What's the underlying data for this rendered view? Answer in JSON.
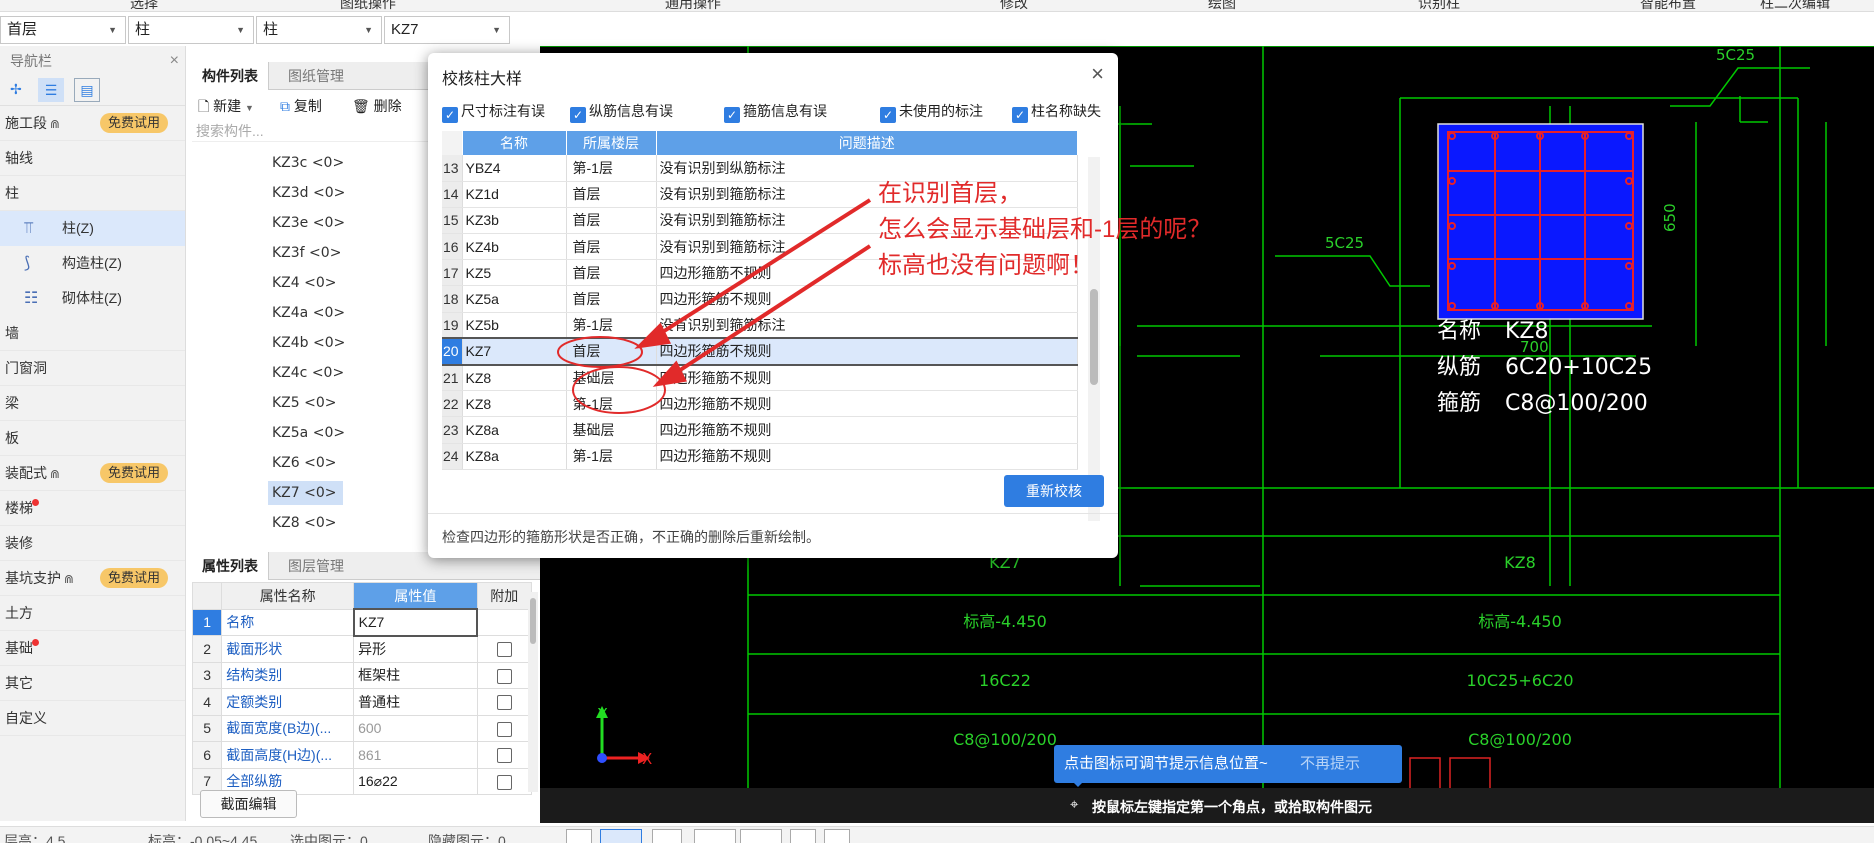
{
  "top_menu": [
    "选择",
    "图纸操作",
    "通用操作",
    "修改",
    "绘图",
    "识别柱",
    "智能布置",
    "柱二次编辑"
  ],
  "selectors": [
    {
      "value": "首层"
    },
    {
      "value": "柱"
    },
    {
      "value": "柱"
    },
    {
      "value": "KZ7"
    }
  ],
  "nav": {
    "title": "导航栏",
    "close": "×",
    "trial_label": "免费试用",
    "items": [
      {
        "label": "施工段",
        "lock": "⋒",
        "trial": true
      },
      {
        "label": "轴线"
      },
      {
        "label": "柱"
      },
      {
        "label": "柱(Z)",
        "sub": true,
        "active": true
      },
      {
        "label": "构造柱(Z)",
        "sub": true
      },
      {
        "label": "砌体柱(Z)",
        "sub": true
      },
      {
        "label": "墙"
      },
      {
        "label": "门窗洞"
      },
      {
        "label": "梁"
      },
      {
        "label": "板"
      },
      {
        "label": "装配式",
        "lock": "⋒",
        "trial": true
      },
      {
        "label": "楼梯",
        "dot": true
      },
      {
        "label": "装修"
      },
      {
        "label": "基坑支护",
        "lock": "⋒",
        "trial": true
      },
      {
        "label": "土方"
      },
      {
        "label": "基础",
        "dot": true
      },
      {
        "label": "其它"
      },
      {
        "label": "自定义"
      }
    ]
  },
  "component_panel": {
    "tabs": [
      "构件列表",
      "图纸管理"
    ],
    "toolbar": {
      "new": "新建",
      "copy": "复制",
      "delete": "删除"
    },
    "search_placeholder": "搜索构件...",
    "items": [
      "KZ3c <0>",
      "KZ3d <0>",
      "KZ3e <0>",
      "KZ3f <0>",
      "KZ4 <0>",
      "KZ4a <0>",
      "KZ4b <0>",
      "KZ4c <0>",
      "KZ5 <0>",
      "KZ5a <0>",
      "KZ6 <0>",
      "KZ7 <0>",
      "KZ8 <0>"
    ],
    "selected": "KZ7 <0>"
  },
  "property_panel": {
    "tabs": [
      "属性列表",
      "图层管理"
    ],
    "headers": [
      "属性名称",
      "属性值",
      "附加"
    ],
    "rows": [
      {
        "n": "1",
        "name": "名称",
        "value": "KZ7",
        "check": false
      },
      {
        "n": "2",
        "name": "截面形状",
        "value": "异形",
        "check": true
      },
      {
        "n": "3",
        "name": "结构类别",
        "value": "框架柱",
        "check": true
      },
      {
        "n": "4",
        "name": "定额类别",
        "value": "普通柱",
        "check": true
      },
      {
        "n": "5",
        "name": "截面宽度(B边)(...",
        "value": "600",
        "check": true
      },
      {
        "n": "6",
        "name": "截面高度(H边)(...",
        "value": "861",
        "check": true
      },
      {
        "n": "7",
        "name": "全部纵筋",
        "value": "16⌀22",
        "check": true
      }
    ],
    "section_edit": "截面编辑"
  },
  "status_bar": {
    "floor_height": "层高：4.5",
    "elevation": "标高：-0.05~4.45",
    "selected": "选中图元：0",
    "hidden": "隐藏图元：0"
  },
  "dialog": {
    "title": "校核柱大样",
    "close": "×",
    "filters": [
      "尺寸标注有误",
      "纵筋信息有误",
      "箍筋信息有误",
      "未使用的标注",
      "柱名称缺失"
    ],
    "columns": [
      "名称",
      "所属楼层",
      "问题描述"
    ],
    "rows": [
      {
        "n": "13",
        "name": "YBZ4",
        "floor": "第-1层",
        "desc": "没有识别到纵筋标注"
      },
      {
        "n": "14",
        "name": "KZ1d",
        "floor": "首层",
        "desc": "没有识别到箍筋标注"
      },
      {
        "n": "15",
        "name": "KZ3b",
        "floor": "首层",
        "desc": "没有识别到箍筋标注"
      },
      {
        "n": "16",
        "name": "KZ4b",
        "floor": "首层",
        "desc": "没有识别到箍筋标注"
      },
      {
        "n": "17",
        "name": "KZ5",
        "floor": "首层",
        "desc": "四边形箍筋不规则"
      },
      {
        "n": "18",
        "name": "KZ5a",
        "floor": "首层",
        "desc": "四边形箍筋不规则"
      },
      {
        "n": "19",
        "name": "KZ5b",
        "floor": "第-1层",
        "desc": "没有识别到箍筋标注"
      },
      {
        "n": "20",
        "name": "KZ7",
        "floor": "首层",
        "desc": "四边形箍筋不规则",
        "selected": true
      },
      {
        "n": "21",
        "name": "KZ8",
        "floor": "基础层",
        "desc": "四边形箍筋不规则"
      },
      {
        "n": "22",
        "name": "KZ8",
        "floor": "第-1层",
        "desc": "四边形箍筋不规则"
      },
      {
        "n": "23",
        "name": "KZ8a",
        "floor": "基础层",
        "desc": "四边形箍筋不规则"
      },
      {
        "n": "24",
        "name": "KZ8a",
        "floor": "第-1层",
        "desc": "四边形箍筋不规则"
      }
    ],
    "recheck_button": "重新校核",
    "hint": "检查四边形的箍筋形状是否正确，不正确的删除后重新绘制。"
  },
  "annotation": {
    "lines": [
      "在识别首层，",
      "怎么会显示基础层和-1层的呢？",
      "标高也没有问题啊！"
    ],
    "color": "#e12a2a"
  },
  "cad": {
    "labels": {
      "top_dim": "5C25",
      "left_dim": "5C25",
      "side_dim": "650",
      "bottom_dim": "700",
      "name_label": "名称",
      "name_value": "KZ8",
      "long_label": "纵筋",
      "long_value": "6C20+10C25",
      "stir_label": "箍筋",
      "stir_value": "C8@100/200"
    },
    "table": {
      "col1": [
        "KZ7",
        "标高-4.450",
        "16C22",
        "C8@100/200"
      ],
      "col2": [
        "KZ8",
        "标高-4.450",
        "10C25+6C20",
        "C8@100/200"
      ]
    },
    "axis_x": "X",
    "axis_y": "Y"
  },
  "tip": {
    "text": "点击图标可调节提示信息位置~",
    "dismiss": "不再提示"
  },
  "command_prompt": "按鼠标左键指定第一个角点，或拾取构件图元"
}
